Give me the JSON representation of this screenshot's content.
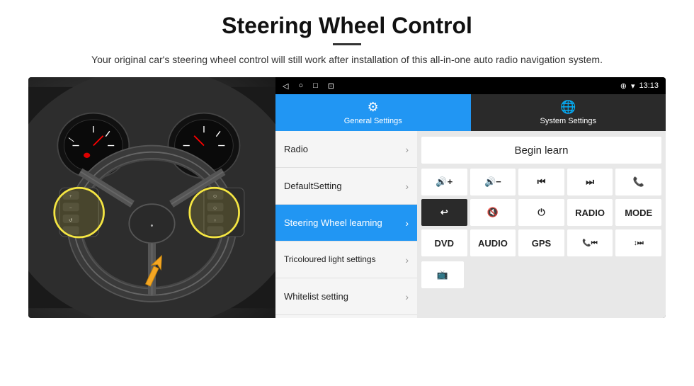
{
  "header": {
    "title": "Steering Wheel Control",
    "divider": true,
    "subtitle": "Your original car's steering wheel control will still work after installation of this all-in-one auto radio navigation system."
  },
  "statusBar": {
    "time": "13:13",
    "icons": [
      "◁",
      "○",
      "□",
      "⊡"
    ]
  },
  "tabs": [
    {
      "id": "general",
      "label": "General Settings",
      "active": true
    },
    {
      "id": "system",
      "label": "System Settings",
      "active": false
    }
  ],
  "menuItems": [
    {
      "id": "radio",
      "label": "Radio",
      "active": false
    },
    {
      "id": "default",
      "label": "DefaultSetting",
      "active": false
    },
    {
      "id": "steering",
      "label": "Steering Wheel learning",
      "active": true
    },
    {
      "id": "tricoloured",
      "label": "Tricoloured light settings",
      "active": false
    },
    {
      "id": "whitelist",
      "label": "Whitelist setting",
      "active": false
    }
  ],
  "beginLearnButton": "Begin learn",
  "controlButtons": {
    "row1": [
      {
        "label": "🔊+",
        "dark": false
      },
      {
        "label": "🔊−",
        "dark": false
      },
      {
        "label": "⏮",
        "dark": false
      },
      {
        "label": "⏭",
        "dark": false
      },
      {
        "label": "📞",
        "dark": false
      }
    ],
    "row2": [
      {
        "label": "↩",
        "dark": true
      },
      {
        "label": "🔇",
        "dark": false
      },
      {
        "label": "⏻",
        "dark": false
      },
      {
        "label": "RADIO",
        "dark": false
      },
      {
        "label": "MODE",
        "dark": false
      }
    ],
    "row3": [
      {
        "label": "DVD",
        "dark": false
      },
      {
        "label": "AUDIO",
        "dark": false
      },
      {
        "label": "GPS",
        "dark": false
      },
      {
        "label": "📞⏮",
        "dark": false
      },
      {
        "label": "↕⏭",
        "dark": false
      }
    ]
  },
  "bottomControl": {
    "icon": "📺"
  }
}
